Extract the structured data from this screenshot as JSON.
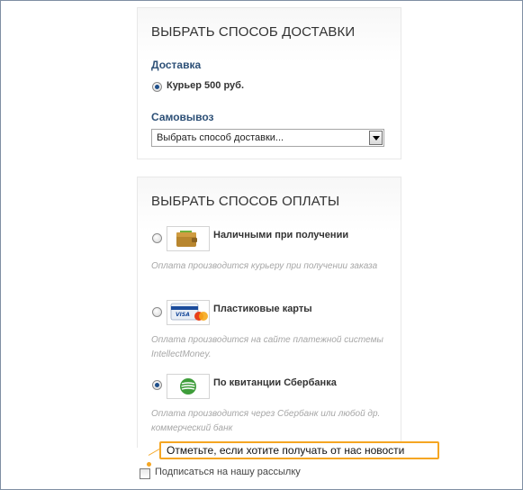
{
  "delivery": {
    "title": "ВЫБРАТЬ СПОСОБ ДОСТАВКИ",
    "section_label": "Доставка",
    "courier_option": "Курьер 500 руб.",
    "pickup_label": "Самовывоз",
    "select_value": "Выбрать способ доставки..."
  },
  "payment": {
    "title": "ВЫБРАТЬ СПОСОБ ОПЛАТЫ",
    "options": [
      {
        "label": "Наличными при получении",
        "description": "Оплата производится курьеру при получении заказа",
        "icon": "wallet-icon",
        "selected": false
      },
      {
        "label": "Пластиковые карты",
        "description": "Оплата производится на сайте платежной системы IntellectMoney.",
        "icon": "credit-card-icon",
        "selected": false
      },
      {
        "label": "По квитанции Сбербанка",
        "description": "Оплата производится через Сбербанк или любой др. коммерческий банк",
        "icon": "sberbank-logo-icon",
        "selected": true
      }
    ]
  },
  "callout": {
    "text": "Отметьте, если хотите получать от нас новости"
  },
  "subscribe": {
    "label": "Подписаться на нашу рассылку"
  },
  "colors": {
    "accent": "#f5a623",
    "section_label": "#2d5077",
    "description": "#a6a6a6"
  }
}
